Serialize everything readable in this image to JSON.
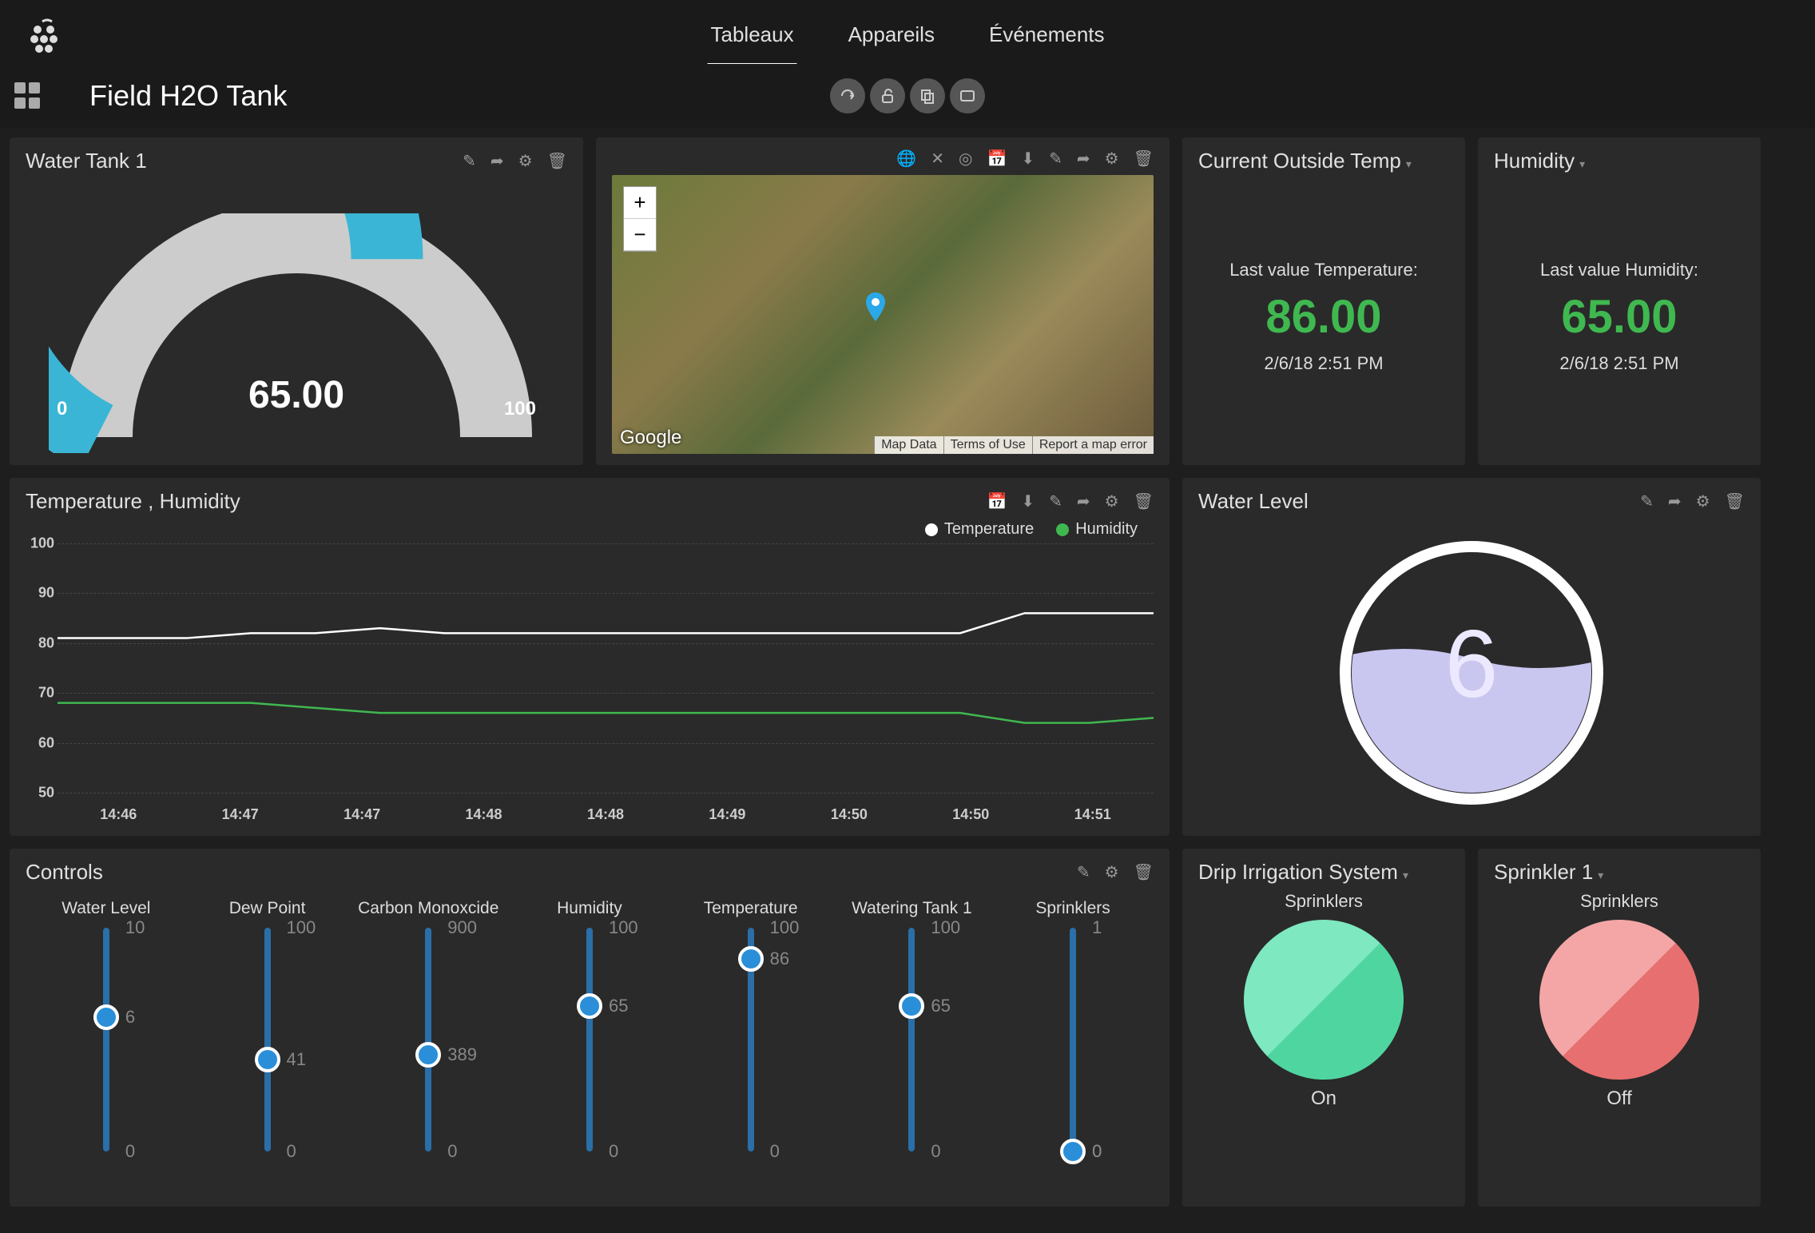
{
  "header": {
    "nav": [
      "Tableaux",
      "Appareils",
      "Événements"
    ],
    "active_nav": 0
  },
  "titlebar": {
    "page_title": "Field H2O Tank"
  },
  "gauge": {
    "title": "Water Tank 1",
    "value": "65.00",
    "min": "0",
    "max": "100",
    "fill_pct": 65
  },
  "map": {
    "attribution_provider": "Google",
    "links": [
      "Map Data",
      "Terms of Use",
      "Report a map error"
    ]
  },
  "temp_card": {
    "title": "Current Outside Temp",
    "label": "Last value Temperature:",
    "value": "86.00",
    "time": "2/6/18 2:51 PM"
  },
  "humidity_card": {
    "title": "Humidity",
    "label": "Last value Humidity:",
    "value": "65.00",
    "time": "2/6/18 2:51 PM"
  },
  "linechart": {
    "title": "Temperature , Humidity",
    "legend": [
      "Temperature",
      "Humidity"
    ]
  },
  "chart_data": {
    "type": "line",
    "title": "Temperature , Humidity",
    "xlabel": "",
    "ylabel": "",
    "ylim": [
      50,
      100
    ],
    "x_ticks": [
      "14:46",
      "14:47",
      "14:47",
      "14:48",
      "14:48",
      "14:49",
      "14:50",
      "14:50",
      "14:51"
    ],
    "y_ticks": [
      50,
      60,
      70,
      80,
      90,
      100
    ],
    "series": [
      {
        "name": "Temperature",
        "color": "#ffffff",
        "values": [
          81,
          81,
          81,
          82,
          82,
          83,
          82,
          82,
          82,
          82,
          82,
          82,
          82,
          82,
          82,
          86,
          86,
          86
        ]
      },
      {
        "name": "Humidity",
        "color": "#3fb850",
        "values": [
          68,
          68,
          68,
          68,
          67,
          66,
          66,
          66,
          66,
          66,
          66,
          66,
          66,
          66,
          66,
          64,
          64,
          65
        ]
      }
    ]
  },
  "waterlevel": {
    "title": "Water Level",
    "value": "6",
    "fill_pct": 60
  },
  "controls": {
    "title": "Controls",
    "sliders": [
      {
        "name": "Water Level",
        "min": 0,
        "max": 10,
        "value": 6
      },
      {
        "name": "Dew Point",
        "min": 0,
        "max": 100,
        "value": 41
      },
      {
        "name": "Carbon Monoxcide",
        "min": 0,
        "max": 900,
        "value": 389
      },
      {
        "name": "Humidity",
        "min": 0,
        "max": 100,
        "value": 65
      },
      {
        "name": "Temperature",
        "min": 0,
        "max": 100,
        "value": 86
      },
      {
        "name": "Watering Tank 1",
        "min": 0,
        "max": 100,
        "value": 65
      },
      {
        "name": "Sprinklers",
        "min": 0,
        "max": 1,
        "value": 0
      }
    ]
  },
  "drip": {
    "title": "Drip Irrigation System",
    "subtitle": "Sprinklers",
    "state": "On",
    "colors": {
      "light": "#7ee8c0",
      "dark": "#4fd6a0"
    }
  },
  "sprinkler": {
    "title": "Sprinkler 1",
    "subtitle": "Sprinklers",
    "state": "Off",
    "colors": {
      "light": "#f4a6a6",
      "dark": "#e86f6f"
    }
  }
}
